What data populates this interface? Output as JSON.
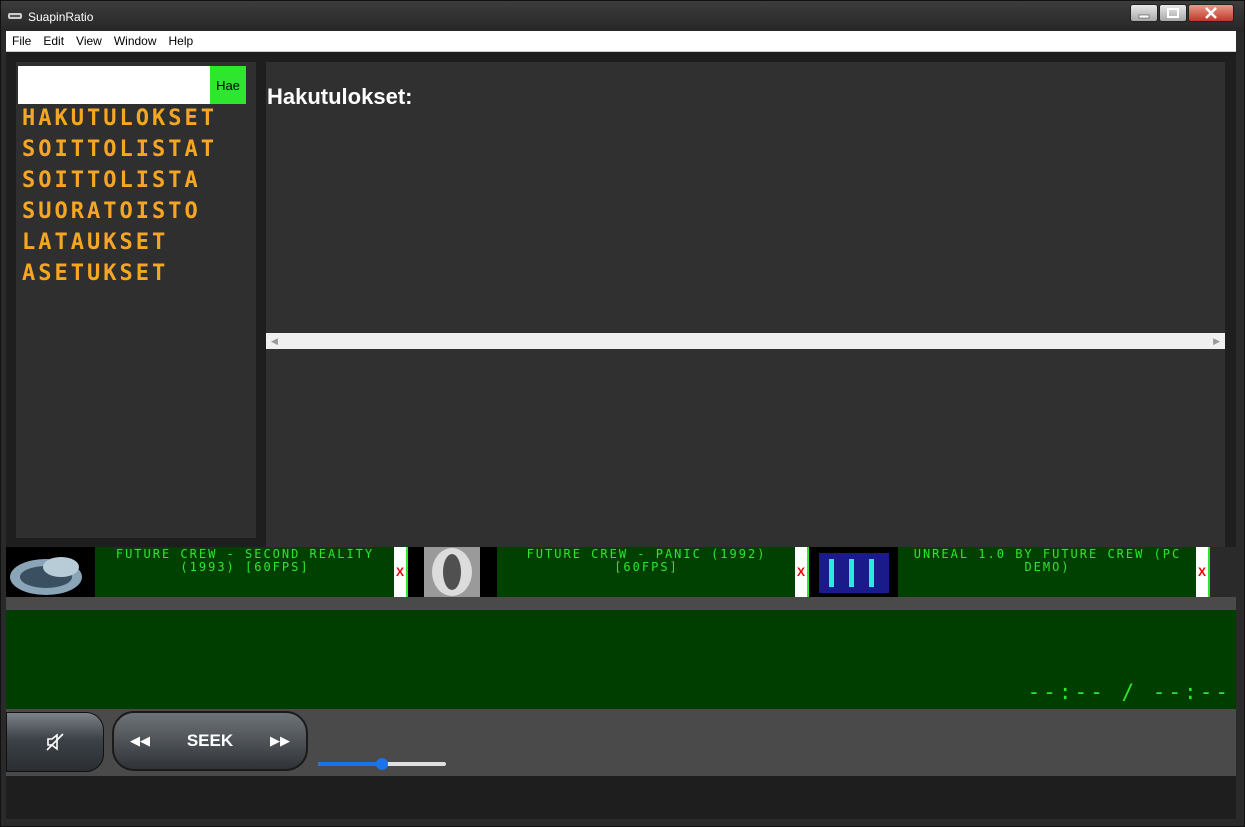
{
  "window": {
    "title": "SuapinRatio"
  },
  "menu": [
    "File",
    "Edit",
    "View",
    "Window",
    "Help"
  ],
  "search": {
    "value": "",
    "button_label": "Hae"
  },
  "nav": [
    "HAKUTULOKSET",
    "SOITTOLISTAT",
    "SOITTOLISTA",
    "SUORATOISTO",
    "LATAUKSET",
    "ASETUKSET"
  ],
  "main": {
    "title": "Hakutulokset:"
  },
  "queue": [
    {
      "title": "FUTURE CREW - SECOND REALITY (1993) [60FPS]",
      "remove": "X"
    },
    {
      "title": "FUTURE CREW - PANIC (1992) [60FPS]",
      "remove": "X"
    },
    {
      "title": "UNREAL 1.0 BY FUTURE CREW (PC DEMO)",
      "remove": "X"
    }
  ],
  "player": {
    "time": "--:-- / --:--",
    "seek_label": "SEEK",
    "rewind": "◀◀",
    "forward": "▶▶",
    "volume": 0.5
  },
  "colors": {
    "accent_orange": "#f5a623",
    "accent_green": "#2ee62e",
    "display_bg": "#003e00"
  }
}
